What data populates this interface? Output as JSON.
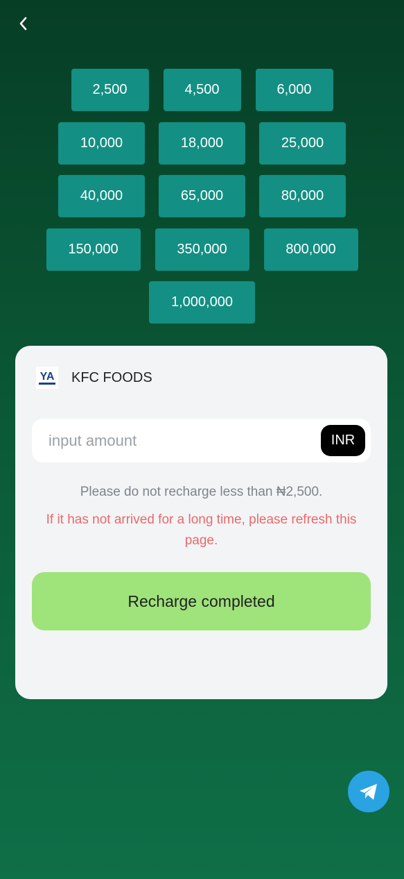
{
  "nav": {
    "back_icon": "chevron-left-icon"
  },
  "amounts": {
    "row1": [
      "2,500",
      "4,500",
      "6,000"
    ],
    "row2": [
      "10,000",
      "18,000",
      "25,000"
    ],
    "row3": [
      "40,000",
      "65,000",
      "80,000"
    ],
    "row4": [
      "150,000",
      "350,000",
      "800,000"
    ],
    "row5": [
      "1,000,000"
    ]
  },
  "merchant": {
    "name": "KFC FOODS",
    "logo_text": "YA"
  },
  "form": {
    "amount_placeholder": "input amount",
    "amount_value": "",
    "currency": "INR"
  },
  "notice": "Please do not recharge less than ₦2,500.",
  "warning": "If it has not arrived for a long time, please refresh this page.",
  "submit_label": "Recharge completed",
  "colors": {
    "amount_button": "#138f83",
    "submit_button": "#9fe37b",
    "warning_text": "#e86a6a",
    "telegram": "#2aa3e2"
  },
  "floating": {
    "icon": "telegram-icon"
  }
}
